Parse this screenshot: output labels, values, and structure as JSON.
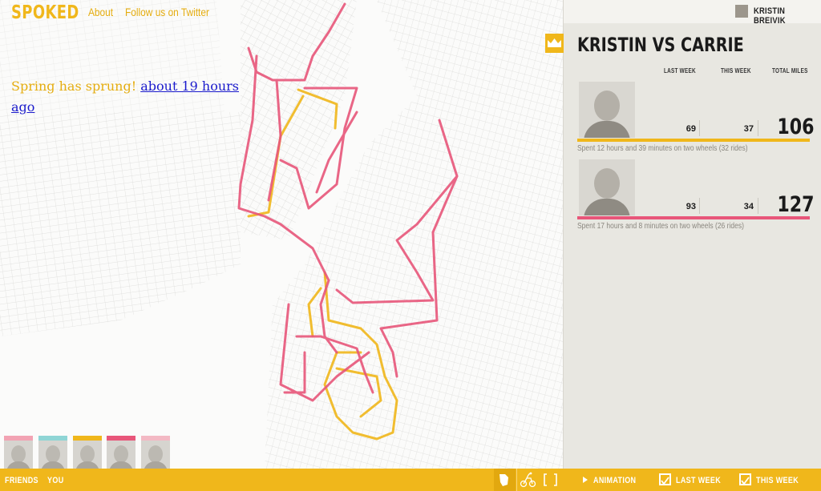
{
  "header": {
    "logo": "SPOKED",
    "nav": {
      "about": "About",
      "twitter": "Follow us on Twitter"
    }
  },
  "status": {
    "text": "Spring has sprung!",
    "link_text": "about 19 hours ago"
  },
  "friends_strip": {
    "bar_colors": [
      "#f2a3b3",
      "#8fd5d5",
      "#f0b71b",
      "#e8567a",
      "#f3b9c4"
    ]
  },
  "sidebar": {
    "user_name": "KRISTIN BREIVIK",
    "matchup_title": "KRISTIN VS CARRIE",
    "columns": {
      "last_week": "LAST WEEK",
      "this_week": "THIS WEEK",
      "total": "TOTAL MILES"
    },
    "riders": [
      {
        "last_week": "69",
        "this_week": "37",
        "total": "106",
        "summary": "Spent 12 hours and 39 minutes on two wheels (32 rides)",
        "color": "#f0b71b"
      },
      {
        "last_week": "93",
        "this_week": "34",
        "total": "127",
        "summary": "Spent 17 hours and 8 minutes on two wheels (26 rides)",
        "color": "#e8567a"
      }
    ]
  },
  "bottom_bar": {
    "friends": "FRIENDS",
    "you": "YOU",
    "animation": "ANIMATION",
    "last_week": "LAST WEEK",
    "this_week": "THIS WEEK",
    "last_week_checked": true,
    "this_week_checked": true
  },
  "colors": {
    "accent": "#f0b71b",
    "rider_yellow": "#f0b71b",
    "rider_pink": "#e8567a",
    "sidebar_bg": "#e8e7e1"
  }
}
